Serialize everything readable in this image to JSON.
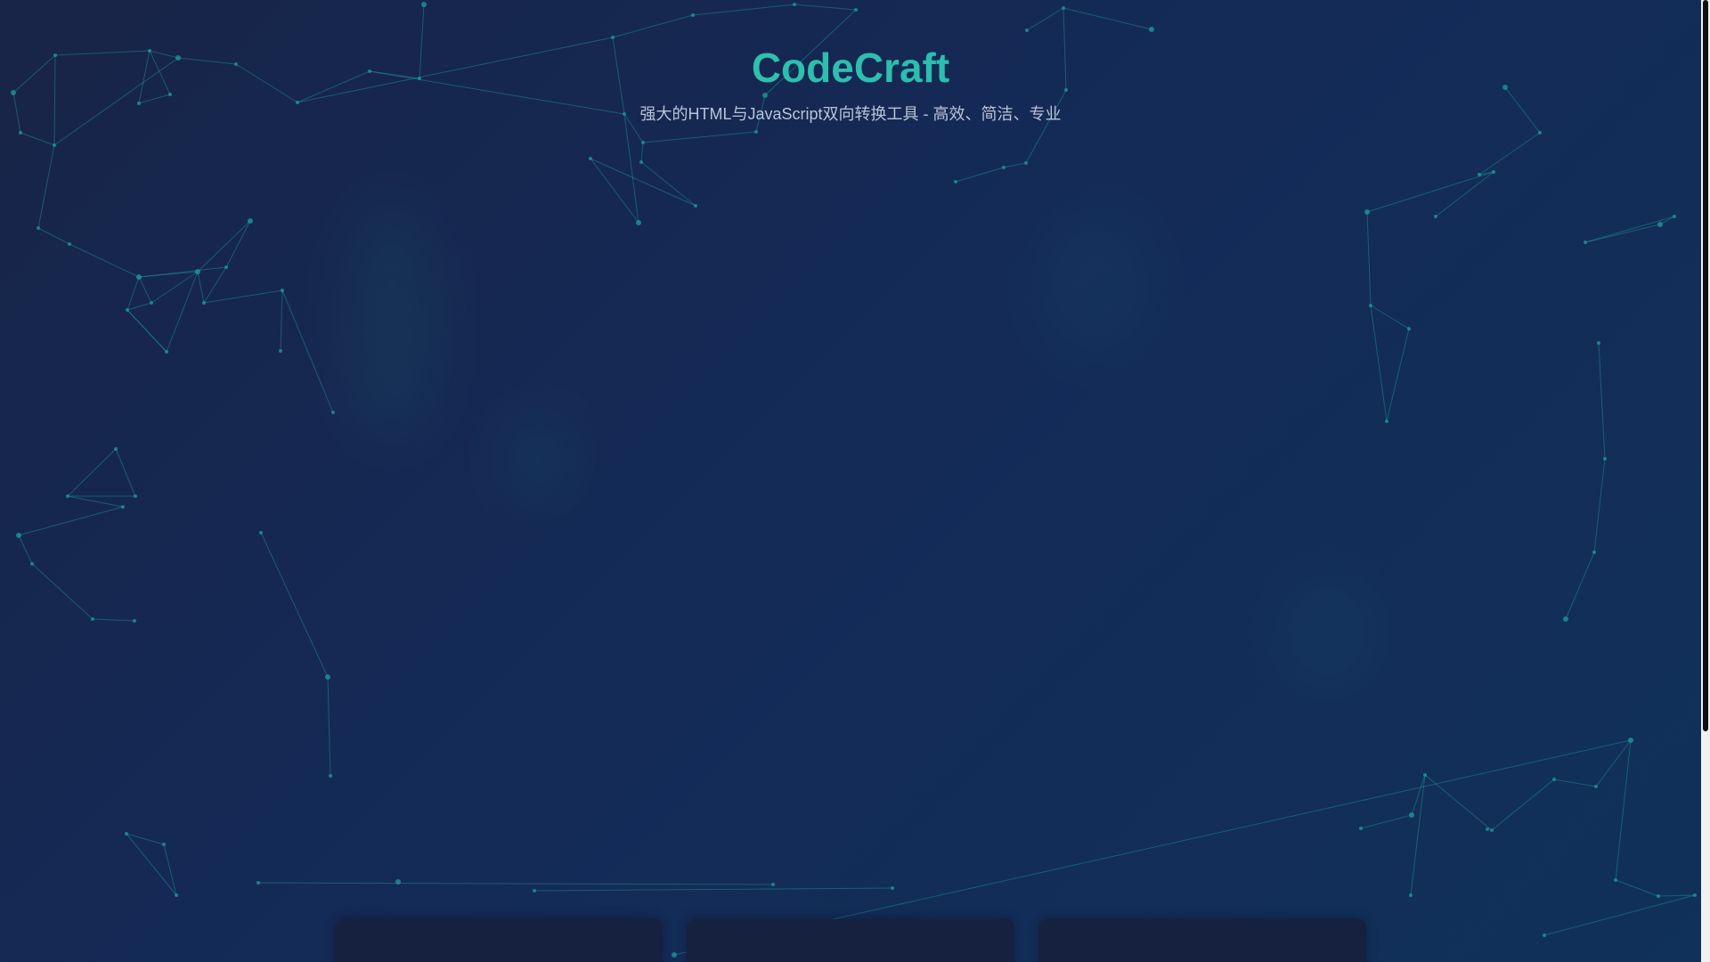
{
  "app": {
    "title": "CodeCraft",
    "subtitle": "强大的HTML与JavaScript双向转换工具 - 高效、简洁、专业"
  },
  "colors": {
    "background_start": "#182447",
    "background_end": "#10315a",
    "accent": "#2ec4b0",
    "particle": "#1f9c9a",
    "card": "#16203f",
    "subtitle_text": "#b9c4d8"
  },
  "cards": [
    {
      "id": "card-1"
    },
    {
      "id": "card-2"
    },
    {
      "id": "card-3"
    }
  ],
  "scroll": {
    "position_fraction": 0.0,
    "visible_fraction": 0.76
  }
}
